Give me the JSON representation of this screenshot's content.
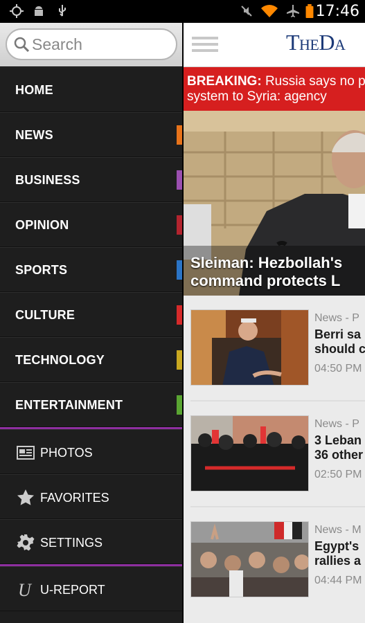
{
  "status_bar": {
    "time": "17:46",
    "icons": [
      "gps-icon",
      "android-debug-icon",
      "usb-icon",
      "mute-icon",
      "wifi-icon",
      "airplane-icon",
      "battery-icon"
    ],
    "battery_color": "#ff8800",
    "wifi_color": "#ff8800"
  },
  "drawer": {
    "search": {
      "placeholder": "Search"
    },
    "sections": [
      {
        "label": "HOME",
        "color": ""
      },
      {
        "label": "NEWS",
        "color": "#e8731a"
      },
      {
        "label": "BUSINESS",
        "color": "#9b4fb0"
      },
      {
        "label": "OPINION",
        "color": "#b3242e"
      },
      {
        "label": "SPORTS",
        "color": "#2a74c6"
      },
      {
        "label": "CULTURE",
        "color": "#d62a2a"
      },
      {
        "label": "TECHNOLOGY",
        "color": "#c9a820"
      },
      {
        "label": "ENTERTAINMENT",
        "color": "#5aa532"
      }
    ],
    "divider_color": "#8e2fa0",
    "extras": [
      {
        "label": "PHOTOS",
        "icon": "photos-icon"
      },
      {
        "label": "FAVORITES",
        "icon": "star-icon"
      },
      {
        "label": "SETTINGS",
        "icon": "gear-icon"
      }
    ],
    "ureport": {
      "label": "U-REPORT",
      "icon": "u-report-icon"
    }
  },
  "main": {
    "logo": "TheDa",
    "breaking": {
      "prefix": "BREAKING:",
      "line1": "Russia says no p",
      "line2": "system to Syria: agency"
    },
    "hero": {
      "line1": "Sleiman: Hezbollah's",
      "line2": "command protects L"
    },
    "stories": [
      {
        "meta": "News - P",
        "h1": "Berri sa",
        "h2": "should c",
        "time": "04:50 PM"
      },
      {
        "meta": "News - P",
        "h1": "3 Leban",
        "h2": "36 other",
        "time": "02:50 PM"
      },
      {
        "meta": "News - M",
        "h1": "Egypt's",
        "h2": "rallies a",
        "time": "04:44 PM"
      }
    ]
  }
}
